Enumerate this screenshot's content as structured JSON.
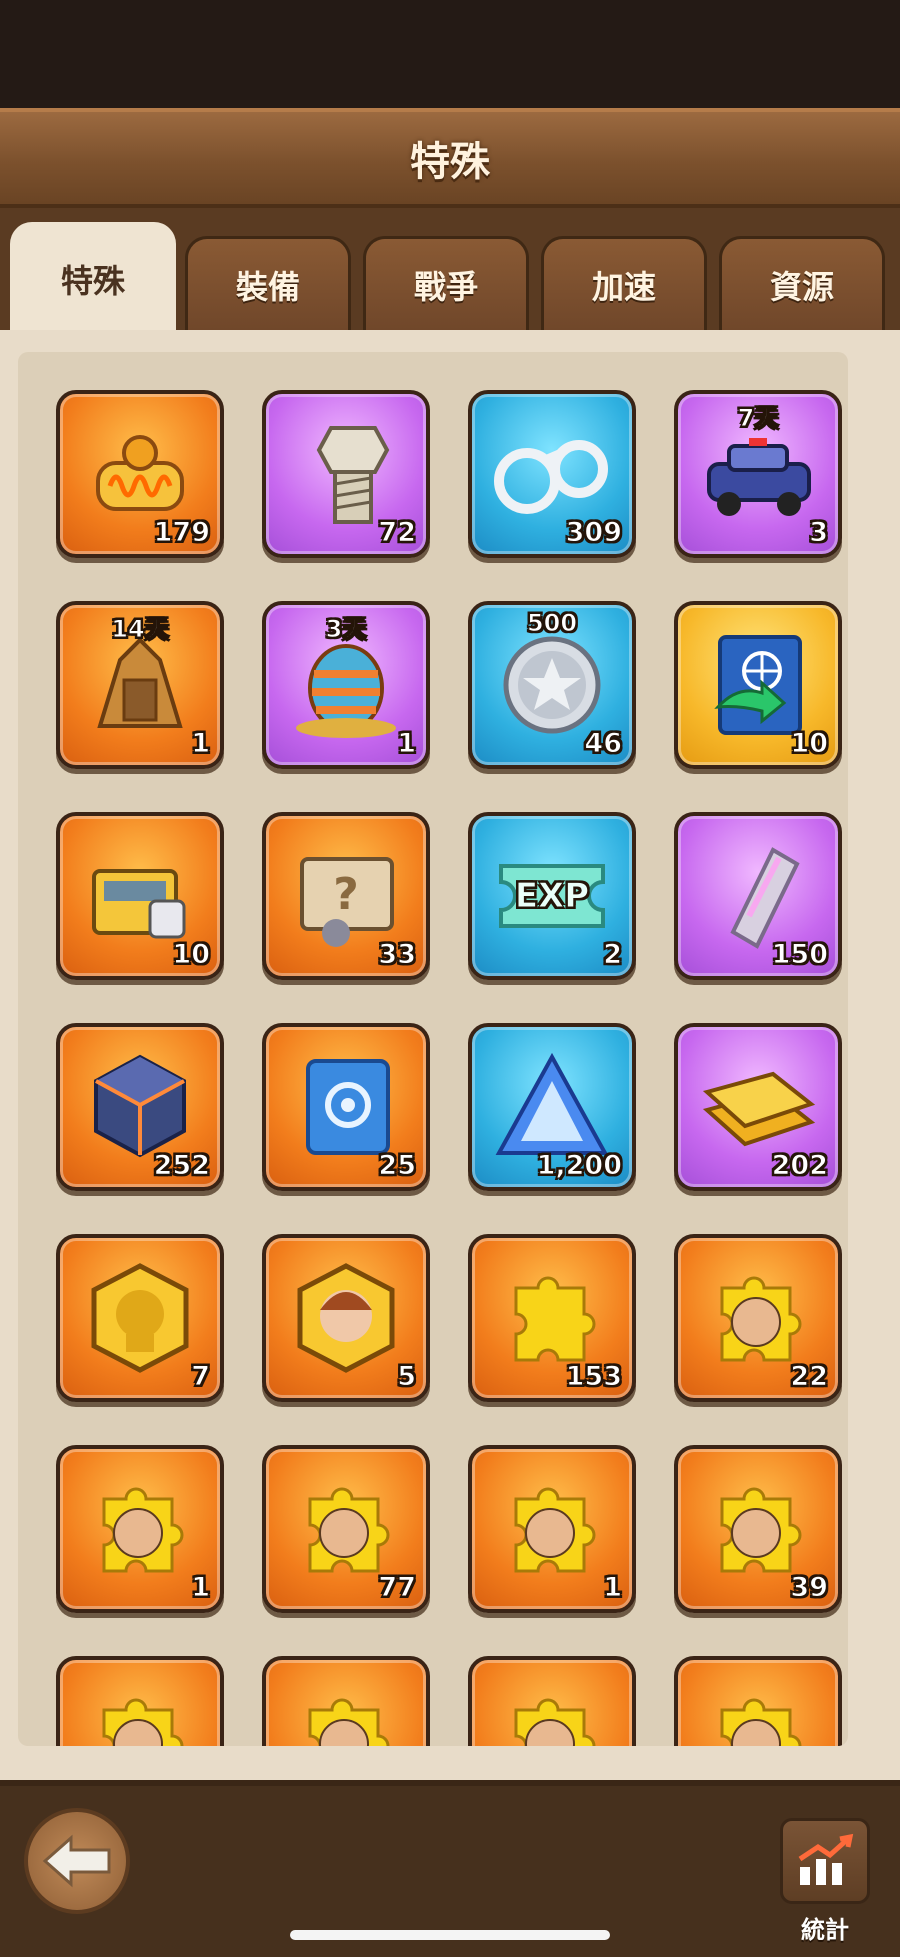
{
  "header": {
    "title": "特殊"
  },
  "tabs": [
    {
      "label": "特殊",
      "active": true
    },
    {
      "label": "裝備",
      "active": false
    },
    {
      "label": "戰爭",
      "active": false
    },
    {
      "label": "加速",
      "active": false
    },
    {
      "label": "資源",
      "active": false
    }
  ],
  "items": [
    {
      "name": "coil-icon",
      "rarity": "orange",
      "count": "179",
      "badge": ""
    },
    {
      "name": "bolt-icon",
      "rarity": "purple",
      "count": "72",
      "badge": ""
    },
    {
      "name": "handcuffs-icon",
      "rarity": "blue",
      "count": "309",
      "badge": ""
    },
    {
      "name": "police-car-icon",
      "rarity": "purple",
      "count": "3",
      "badge": "7天"
    },
    {
      "name": "tower-icon",
      "rarity": "orange",
      "count": "1",
      "badge": "14天"
    },
    {
      "name": "egg-house-icon",
      "rarity": "purple",
      "count": "1",
      "badge": "3天"
    },
    {
      "name": "silver-coin-icon",
      "rarity": "blue",
      "count": "46",
      "badge": "500"
    },
    {
      "name": "passport-icon",
      "rarity": "gold",
      "count": "10",
      "badge": ""
    },
    {
      "name": "chest-icon",
      "rarity": "orange",
      "count": "10",
      "badge": ""
    },
    {
      "name": "mystery-crate-icon",
      "rarity": "orange",
      "count": "33",
      "badge": ""
    },
    {
      "name": "exp-ticket-icon",
      "rarity": "blue",
      "count": "2",
      "badge": "",
      "label": "EXP"
    },
    {
      "name": "silver-bar-icon",
      "rarity": "purple",
      "count": "150",
      "badge": ""
    },
    {
      "name": "cube-icon",
      "rarity": "orange",
      "count": "252",
      "badge": ""
    },
    {
      "name": "blueprint-icon",
      "rarity": "orange",
      "count": "25",
      "badge": ""
    },
    {
      "name": "crystal-prism-icon",
      "rarity": "blue",
      "count": "1,200",
      "badge": ""
    },
    {
      "name": "gold-bars-icon",
      "rarity": "purple",
      "count": "202",
      "badge": ""
    },
    {
      "name": "hero-medal-male-icon",
      "rarity": "orange",
      "count": "7",
      "badge": ""
    },
    {
      "name": "hero-medal-female-icon",
      "rarity": "orange",
      "count": "5",
      "badge": ""
    },
    {
      "name": "puzzle-piece-icon",
      "rarity": "orange",
      "count": "153",
      "badge": ""
    },
    {
      "name": "puzzle-blonde-woman-icon",
      "rarity": "orange",
      "count": "22",
      "badge": ""
    },
    {
      "name": "puzzle-officer-icon",
      "rarity": "orange",
      "count": "1",
      "badge": ""
    },
    {
      "name": "puzzle-bandana-man-icon",
      "rarity": "orange",
      "count": "77",
      "badge": ""
    },
    {
      "name": "puzzle-sunglasses-man-icon",
      "rarity": "orange",
      "count": "1",
      "badge": ""
    },
    {
      "name": "puzzle-glasses-woman-icon",
      "rarity": "orange",
      "count": "39",
      "badge": ""
    },
    {
      "name": "puzzle-bearded-man-icon",
      "rarity": "orange",
      "count": "",
      "badge": ""
    },
    {
      "name": "puzzle-old-man-icon",
      "rarity": "orange",
      "count": "",
      "badge": ""
    },
    {
      "name": "puzzle-hooded-man-icon",
      "rarity": "orange",
      "count": "",
      "badge": ""
    },
    {
      "name": "puzzle-masked-woman-icon",
      "rarity": "orange",
      "count": "",
      "badge": ""
    }
  ],
  "footer": {
    "stats_label": "統計"
  },
  "colors": {
    "orange": "#f27d1c",
    "purple": "#c768ef",
    "blue": "#2fb0e0",
    "gold": "#f7b82a",
    "wood": "#7c512d",
    "panel": "#e8dcc9"
  }
}
